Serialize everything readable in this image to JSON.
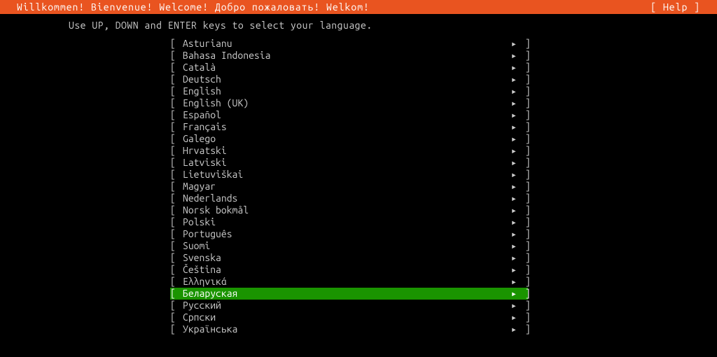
{
  "header": {
    "title": "Willkommen! Bienvenue! Welcome! Добро пожаловать! Welkom!",
    "help": "[ Help ]"
  },
  "instruction": "Use UP, DOWN and ENTER keys to select your language.",
  "arrow_glyph": "▸",
  "bracket_left": "[ ",
  "bracket_right": " ]",
  "selected_index": 21,
  "languages": [
    {
      "name": "Asturianu"
    },
    {
      "name": "Bahasa Indonesia"
    },
    {
      "name": "Català"
    },
    {
      "name": "Deutsch"
    },
    {
      "name": "English"
    },
    {
      "name": "English (UK)"
    },
    {
      "name": "Español"
    },
    {
      "name": "Français"
    },
    {
      "name": "Galego"
    },
    {
      "name": "Hrvatski"
    },
    {
      "name": "Latviski"
    },
    {
      "name": "Lietuviškai"
    },
    {
      "name": "Magyar"
    },
    {
      "name": "Nederlands"
    },
    {
      "name": "Norsk bokmål"
    },
    {
      "name": "Polski"
    },
    {
      "name": "Português"
    },
    {
      "name": "Suomi"
    },
    {
      "name": "Svenska"
    },
    {
      "name": "Čeština"
    },
    {
      "name": "Ελληνικά"
    },
    {
      "name": "Беларуская"
    },
    {
      "name": "Русский"
    },
    {
      "name": "Српски"
    },
    {
      "name": "Українська"
    }
  ]
}
